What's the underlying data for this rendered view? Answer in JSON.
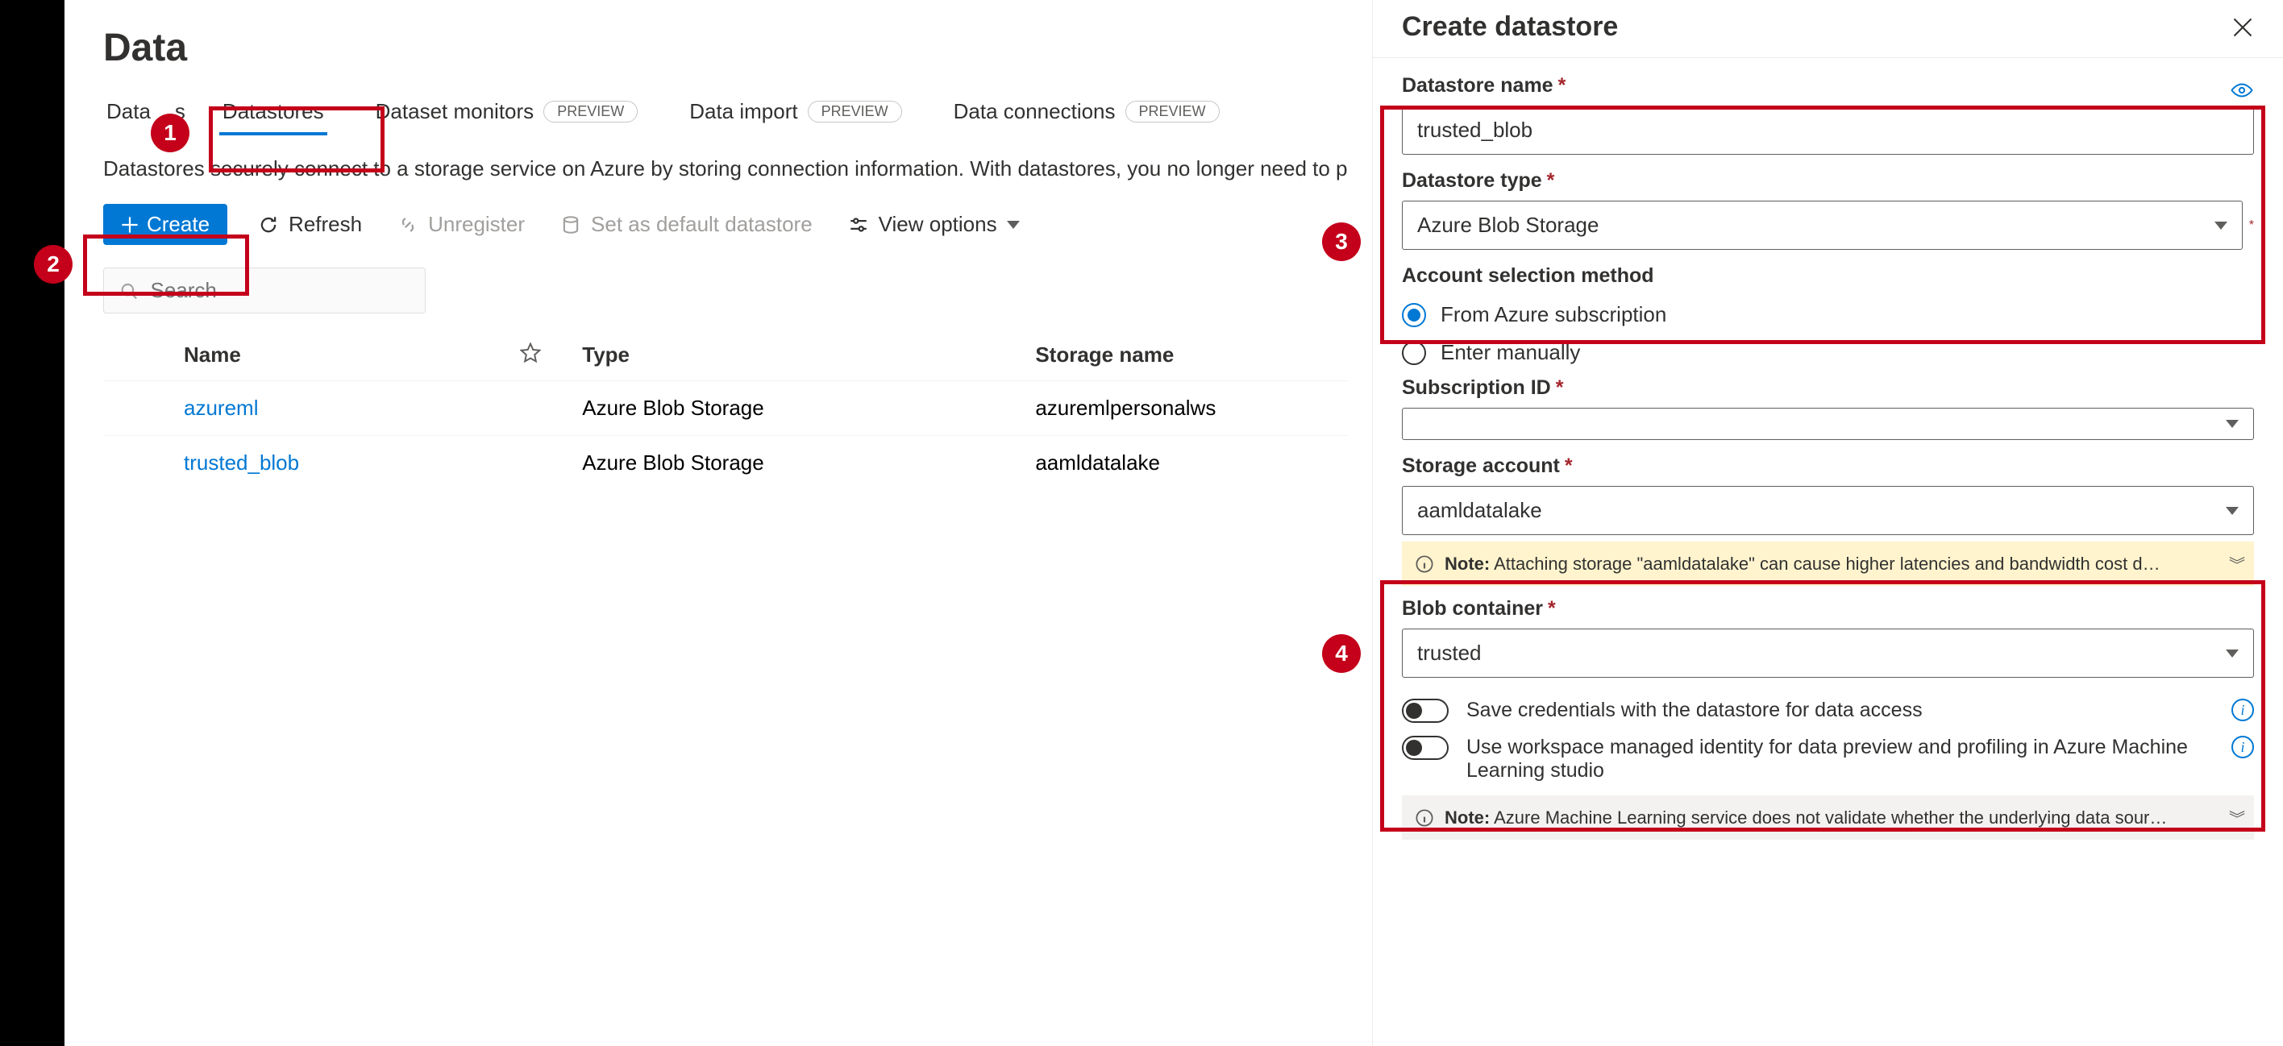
{
  "page": {
    "title": "Data",
    "description": "Datastores securely connect to a storage service on Azure by storing connection information. With datastores, you no longer need to p"
  },
  "tabs": {
    "data": "Data",
    "assets_suffix": "s",
    "datastores": "Datastores",
    "monitors": "Dataset monitors",
    "import": "Data import",
    "connections": "Data connections",
    "preview_badge": "PREVIEW"
  },
  "toolbar": {
    "create": "Create",
    "refresh": "Refresh",
    "unregister": "Unregister",
    "set_default": "Set as default datastore",
    "view_options": "View options"
  },
  "search": {
    "placeholder": "Search"
  },
  "table": {
    "headers": {
      "name": "Name",
      "type": "Type",
      "storage": "Storage name"
    },
    "rows": [
      {
        "name": "azureml",
        "type": "Azure Blob Storage",
        "storage": "azuremlpersonalws"
      },
      {
        "name": "trusted_blob",
        "type": "Azure Blob Storage",
        "storage": "aamldatalake"
      }
    ]
  },
  "panel": {
    "title": "Create datastore",
    "name_label": "Datastore name",
    "name_value": "trusted_blob",
    "type_label": "Datastore type",
    "type_value": "Azure Blob Storage",
    "acct_method_label": "Account selection method",
    "radio_from_sub": "From Azure subscription",
    "radio_manual": "Enter manually",
    "sub_label": "Subscription ID",
    "sub_value": "",
    "storage_label": "Storage account",
    "storage_value": "aamldatalake",
    "blob_label": "Blob container",
    "blob_value": "trusted",
    "note_prefix": "Note:",
    "note_storage": " Attaching storage \"aamldatalake\" can cause higher latencies and bandwidth cost d…",
    "toggle_save_creds": "Save credentials with the datastore for data access",
    "toggle_identity": "Use workspace managed identity for data preview and profiling in Azure Machine Learning studio",
    "note_validate": " Azure Machine Learning service does not validate whether the underlying data sour…"
  },
  "ann": {
    "1": "1",
    "2": "2",
    "3": "3",
    "4": "4"
  }
}
